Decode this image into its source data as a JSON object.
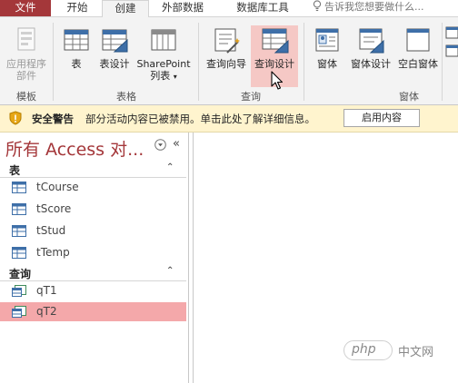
{
  "tabs": {
    "file": "文件",
    "home": "开始",
    "create": "创建",
    "external": "外部数据",
    "dbtools": "数据库工具",
    "tellme": "告诉我您想要做什么..."
  },
  "ribbon": {
    "templates": {
      "app_parts_line1": "应用程序",
      "app_parts_line2": "部件",
      "group": "模板"
    },
    "tables": {
      "table": "表",
      "table_design": "表设计",
      "sharepoint_line1": "SharePoint",
      "sharepoint_line2": "列表",
      "group": "表格"
    },
    "queries": {
      "wizard": "查询向导",
      "design": "查询设计",
      "group": "查询"
    },
    "forms": {
      "form": "窗体",
      "form_design": "窗体设计",
      "blank_form": "空白窗体",
      "group": "窗体"
    }
  },
  "security": {
    "title": "安全警告",
    "message": "部分活动内容已被禁用。单击此处了解详细信息。",
    "button": "启用内容"
  },
  "nav": {
    "title": "所有 Access 对...",
    "shutter": "«",
    "groups": {
      "tables": "表",
      "queries": "查询"
    },
    "tables": [
      "tCourse",
      "tScore",
      "tStud",
      "tTemp"
    ],
    "queries": [
      "qT1",
      "qT2"
    ]
  },
  "watermark": {
    "php": "php",
    "cn": "中文网"
  },
  "colors": {
    "file_tab": "#a4373a",
    "nav_title": "#a4373a",
    "selected_row": "#f4a8aa",
    "security_bar": "#fff4ce"
  }
}
